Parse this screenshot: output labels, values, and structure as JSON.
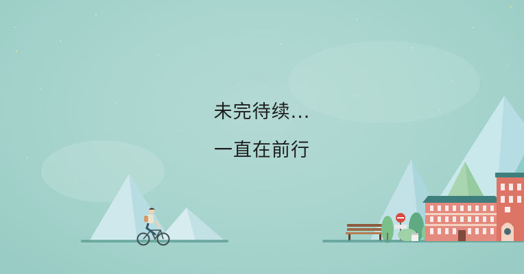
{
  "slide": {
    "line1": "未完待续...",
    "line2": "一直在前行"
  },
  "colors": {
    "background": "#a6d4cd",
    "mountain_light": "#cde8ea",
    "mountain_mid": "#8fcbc7",
    "mountain_green": "#a9d6b0",
    "building_brick": "#e58a7e",
    "building_roof": "#3e7e7c",
    "ground": "#5c9e94",
    "text": "#1e1e1e"
  },
  "illustration": {
    "icons": [
      "mountain-icon",
      "cyclist-icon",
      "bench-icon",
      "tree-icon",
      "no-entry-sign-icon",
      "building-icon",
      "clock-tower-icon"
    ]
  }
}
